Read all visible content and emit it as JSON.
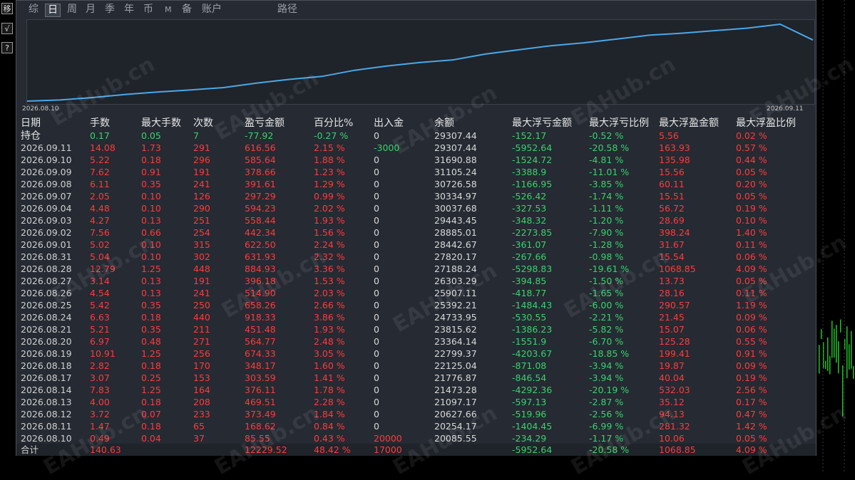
{
  "tools": {
    "move_label": "移",
    "check_label": "√",
    "help_label": "?"
  },
  "tabs": [
    {
      "label": "综",
      "active": false
    },
    {
      "label": "日",
      "active": true
    },
    {
      "label": "周",
      "active": false
    },
    {
      "label": "月",
      "active": false
    },
    {
      "label": "季",
      "active": false
    },
    {
      "label": "年",
      "active": false
    },
    {
      "label": "币",
      "active": false
    },
    {
      "label": "M",
      "active": false
    },
    {
      "label": "备",
      "active": false
    },
    {
      "label": "账户",
      "active": false
    },
    {
      "label": "路径",
      "active": false
    }
  ],
  "equity_curve": {
    "start_label": "2026.08.10",
    "end_label": "2026.09.11",
    "start_value": 20085.55,
    "end_value": 29307.44,
    "color": "#4aa8e8"
  },
  "watermark": "EAHub.cn",
  "table": {
    "headers": [
      "日期",
      "手数",
      "最大手数",
      "次数",
      "盈亏金额",
      "百分比%",
      "出入金",
      "余额",
      "最大浮亏金额",
      "最大浮亏比例",
      "最大浮盈金额",
      "最大浮盈比例"
    ],
    "position": [
      "持仓",
      "0.17",
      "0.05",
      "7",
      "-77.92",
      "-0.27 %",
      "0",
      "29307.44",
      "-152.17",
      "-0.52 %",
      "5.56",
      "0.02 %"
    ],
    "rows": [
      [
        "2026.09.11",
        "14.08",
        "1.73",
        "291",
        "616.56",
        "2.15 %",
        "-3000",
        "29307.44",
        "-5952.64",
        "-20.58 %",
        "163.93",
        "0.57 %"
      ],
      [
        "2026.09.10",
        "5.22",
        "0.18",
        "296",
        "585.64",
        "1.88 %",
        "0",
        "31690.88",
        "-1524.72",
        "-4.81 %",
        "135.98",
        "0.44 %"
      ],
      [
        "2026.09.09",
        "7.62",
        "0.91",
        "191",
        "378.66",
        "1.23 %",
        "0",
        "31105.24",
        "-3388.9",
        "-11.01 %",
        "15.56",
        "0.05 %"
      ],
      [
        "2026.09.08",
        "6.11",
        "0.35",
        "241",
        "391.61",
        "1.29 %",
        "0",
        "30726.58",
        "-1166.95",
        "-3.85 %",
        "60.11",
        "0.20 %"
      ],
      [
        "2026.09.07",
        "2.05",
        "0.10",
        "126",
        "297.29",
        "0.99 %",
        "0",
        "30334.97",
        "-526.42",
        "-1.74 %",
        "15.51",
        "0.05 %"
      ],
      [
        "2026.09.04",
        "4.48",
        "0.10",
        "290",
        "594.23",
        "2.02 %",
        "0",
        "30037.68",
        "-327.53",
        "-1.11 %",
        "56.72",
        "0.19 %"
      ],
      [
        "2026.09.03",
        "4.27",
        "0.13",
        "251",
        "558.44",
        "1.93 %",
        "0",
        "29443.45",
        "-348.32",
        "-1.20 %",
        "28.69",
        "0.10 %"
      ],
      [
        "2026.09.02",
        "7.56",
        "0.66",
        "254",
        "442.34",
        "1.56 %",
        "0",
        "28885.01",
        "-2273.85",
        "-7.90 %",
        "398.24",
        "1.40 %"
      ],
      [
        "2026.09.01",
        "5.02",
        "0.10",
        "315",
        "622.50",
        "2.24 %",
        "0",
        "28442.67",
        "-361.07",
        "-1.28 %",
        "31.67",
        "0.11 %"
      ],
      [
        "2026.08.31",
        "5.04",
        "0.10",
        "302",
        "631.93",
        "2.32 %",
        "0",
        "27820.17",
        "-267.66",
        "-0.98 %",
        "15.54",
        "0.06 %"
      ],
      [
        "2026.08.28",
        "12.79",
        "1.25",
        "448",
        "884.93",
        "3.36 %",
        "0",
        "27188.24",
        "-5298.83",
        "-19.61 %",
        "1068.85",
        "4.09 %"
      ],
      [
        "2026.08.27",
        "3.14",
        "0.13",
        "191",
        "396.18",
        "1.53 %",
        "0",
        "26303.29",
        "-394.85",
        "-1.50 %",
        "13.73",
        "0.05 %"
      ],
      [
        "2026.08.26",
        "4.54",
        "0.13",
        "241",
        "514.90",
        "2.03 %",
        "0",
        "25907.11",
        "-418.77",
        "-1.65 %",
        "28.16",
        "0.11 %"
      ],
      [
        "2026.08.25",
        "5.42",
        "0.35",
        "250",
        "658.26",
        "2.66 %",
        "0",
        "25392.21",
        "-1484.43",
        "-6.00 %",
        "290.57",
        "1.19 %"
      ],
      [
        "2026.08.24",
        "6.63",
        "0.18",
        "440",
        "918.33",
        "3.86 %",
        "0",
        "24733.95",
        "-530.55",
        "-2.21 %",
        "21.45",
        "0.09 %"
      ],
      [
        "2026.08.21",
        "5.21",
        "0.35",
        "211",
        "451.48",
        "1.93 %",
        "0",
        "23815.62",
        "-1386.23",
        "-5.82 %",
        "15.07",
        "0.06 %"
      ],
      [
        "2026.08.20",
        "6.97",
        "0.48",
        "271",
        "564.77",
        "2.48 %",
        "0",
        "23364.14",
        "-1551.9",
        "-6.70 %",
        "125.28",
        "0.55 %"
      ],
      [
        "2026.08.19",
        "10.91",
        "1.25",
        "256",
        "674.33",
        "3.05 %",
        "0",
        "22799.37",
        "-4203.67",
        "-18.85 %",
        "199.41",
        "0.91 %"
      ],
      [
        "2026.08.18",
        "2.82",
        "0.18",
        "170",
        "348.17",
        "1.60 %",
        "0",
        "22125.04",
        "-871.08",
        "-3.94 %",
        "19.87",
        "0.09 %"
      ],
      [
        "2026.08.17",
        "3.07",
        "0.25",
        "153",
        "303.59",
        "1.41 %",
        "0",
        "21776.87",
        "-846.54",
        "-3.94 %",
        "40.04",
        "0.19 %"
      ],
      [
        "2026.08.14",
        "7.83",
        "1.25",
        "164",
        "376.11",
        "1.78 %",
        "0",
        "21473.28",
        "-4292.36",
        "-20.19 %",
        "532.03",
        "2.56 %"
      ],
      [
        "2026.08.13",
        "4.00",
        "0.18",
        "208",
        "469.51",
        "2.28 %",
        "0",
        "21097.17",
        "-597.13",
        "-2.87 %",
        "35.12",
        "0.17 %"
      ],
      [
        "2026.08.12",
        "3.72",
        "0.07",
        "233",
        "373.49",
        "1.84 %",
        "0",
        "20627.66",
        "-519.96",
        "-2.56 %",
        "94.13",
        "0.47 %"
      ],
      [
        "2026.08.11",
        "1.47",
        "0.18",
        "65",
        "168.62",
        "0.84 %",
        "0",
        "20254.17",
        "-1404.45",
        "-6.99 %",
        "281.32",
        "1.42 %"
      ],
      [
        "2026.08.10",
        "0.49",
        "0.04",
        "37",
        "85.55",
        "0.43 %",
        "20000",
        "20085.55",
        "-234.29",
        "-1.17 %",
        "10.06",
        "0.05 %"
      ]
    ],
    "total": [
      "合计",
      "140.63",
      "",
      "",
      "12229.52",
      "48.42 %",
      "17000",
      "",
      "-5952.64",
      "-20.58 %",
      "1068.85",
      "4.09 %"
    ]
  },
  "colors": {
    "profit": "#ff3b3b",
    "loss": "#39d36a",
    "panel": "#252a33",
    "curve": "#4aa8e8"
  }
}
